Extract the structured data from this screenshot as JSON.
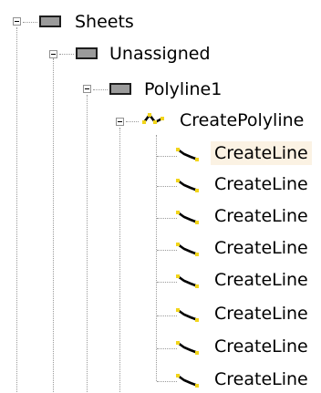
{
  "tree": {
    "sheets": {
      "label": "Sheets",
      "icon": "sheet-folder-icon"
    },
    "unassigned": {
      "label": "Unassigned",
      "icon": "layer-folder-icon"
    },
    "polyline1": {
      "label": "Polyline1",
      "icon": "entity-folder-icon"
    },
    "create_polyline": {
      "label": "CreatePolyline",
      "icon": "polyline-icon"
    },
    "create_lines": [
      {
        "label": "CreateLine",
        "selected": true
      },
      {
        "label": "CreateLine",
        "selected": false
      },
      {
        "label": "CreateLine",
        "selected": false
      },
      {
        "label": "CreateLine",
        "selected": false
      },
      {
        "label": "CreateLine",
        "selected": false
      },
      {
        "label": "CreateLine",
        "selected": false
      },
      {
        "label": "CreateLine",
        "selected": false
      },
      {
        "label": "CreateLine",
        "selected": false
      }
    ]
  },
  "colors": {
    "selection_bg": "#fbf2e3",
    "folder_fill": "#9b9b9b",
    "line_icon_yellow": "#f2d51a",
    "tree_line": "#9a9a9a"
  }
}
